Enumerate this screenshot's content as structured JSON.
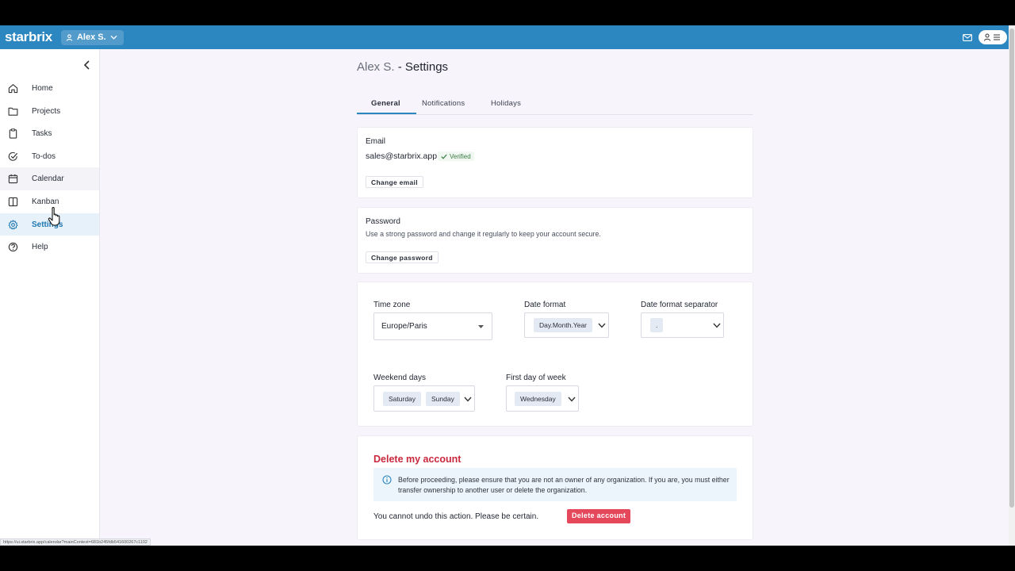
{
  "topbar": {
    "logo": "starbrix",
    "user_label": "Alex S.",
    "icons": [
      "user-icon",
      "chevron-down-icon",
      "mail-icon",
      "account-menu-icon"
    ]
  },
  "sidebar": {
    "items": [
      {
        "label": "Home",
        "icon": "home-icon"
      },
      {
        "label": "Projects",
        "icon": "folder-icon"
      },
      {
        "label": "Tasks",
        "icon": "clipboard-icon"
      },
      {
        "label": "To-dos",
        "icon": "check-circle-icon"
      },
      {
        "label": "Calendar",
        "icon": "calendar-icon"
      },
      {
        "label": "Kanban",
        "icon": "kanban-icon"
      },
      {
        "label": "Settings",
        "icon": "gear-icon"
      },
      {
        "label": "Help",
        "icon": "help-icon"
      }
    ],
    "active": "Settings"
  },
  "page": {
    "title_name": "Alex S.",
    "title_suffix": " - Settings"
  },
  "tabs": [
    {
      "label": "General"
    },
    {
      "label": "Notifications"
    },
    {
      "label": "Holidays"
    }
  ],
  "email_card": {
    "label": "Email",
    "value": "sales@starbrix.app",
    "verified": "Verified",
    "button": "Change email"
  },
  "password_card": {
    "label": "Password",
    "description": "Use a strong password and change it regularly to keep your account secure.",
    "button": "Change password"
  },
  "preferences": {
    "time_zone_label": "Time zone",
    "time_zone_value": "Europe/Paris",
    "date_format_label": "Date format",
    "date_format_value": "Day.Month.Year",
    "separator_label": "Date format separator",
    "separator_value": ".",
    "weekend_label": "Weekend days",
    "weekend_values": [
      "Saturday",
      "Sunday"
    ],
    "first_day_label": "First day of week",
    "first_day_value": "Wednesday"
  },
  "delete_card": {
    "title": "Delete my account",
    "info": "Before proceeding, please ensure that you are not an owner of any organization. If you are, you must either transfer ownership to another user or delete the organization.",
    "warning": "You cannot undo this action. Please be certain.",
    "button": "Delete account"
  },
  "status_bar_url": "https://ui.starbrix.app/calendar?mainContext=681b245fdb541600267c1102",
  "colors": {
    "brand": "#2c86c0",
    "danger": "#e5485b",
    "danger_text": "#c8283c",
    "verified": "#3a7d44"
  }
}
